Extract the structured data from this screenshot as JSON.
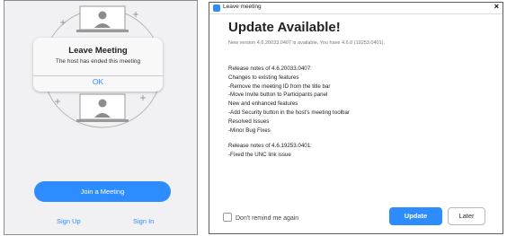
{
  "phone": {
    "dialog": {
      "title": "Leave Meeting",
      "message": "The host has ended this meeting",
      "ok_label": "OK"
    },
    "join_label": "Join a Meeting",
    "sign_up_label": "Sign Up",
    "sign_in_label": "Sign In"
  },
  "update_window": {
    "window_title": "Leave meeting",
    "close_label": "×",
    "title": "Update Available!",
    "subtitle": "New version 4.6.20033.0407 is available. You have 4.6.0 (19253.0401).",
    "notes": [
      "Release notes of 4.6.20033.0407:",
      "Changes to existing features",
      "-Remove the meeting ID from the title bar",
      "-Move Invite button to Participants panel",
      "New and enhanced features",
      "-Add Security button in the host's meeting toolbar",
      "Resolved Issues",
      "-Minor Bug Fixes",
      "",
      "Release notes of 4.6.19253.0401:",
      "-Fixed the UNC link issue"
    ],
    "remind_label": "Don't remind me again",
    "update_label": "Update",
    "later_label": "Later"
  },
  "colors": {
    "accent": "#2d8cff",
    "phone_background": "#f1f1f4"
  }
}
